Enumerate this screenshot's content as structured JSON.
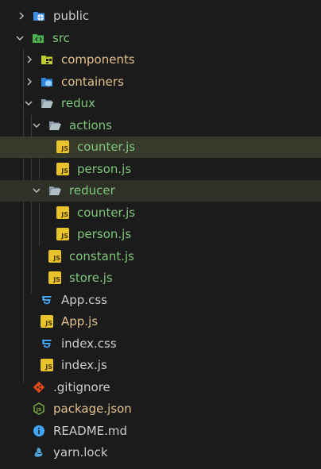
{
  "explorer": {
    "items": [
      {
        "label": "public",
        "kind": "folder",
        "icon": "public-folder-icon",
        "expanded": false
      },
      {
        "label": "src",
        "kind": "folder",
        "icon": "src-folder-icon",
        "expanded": true
      },
      {
        "label": "components",
        "kind": "folder",
        "icon": "components-folder-icon",
        "expanded": false
      },
      {
        "label": "containers",
        "kind": "folder",
        "icon": "containers-folder-icon",
        "expanded": false
      },
      {
        "label": "redux",
        "kind": "folder",
        "icon": "folder-open-icon",
        "expanded": true
      },
      {
        "label": "actions",
        "kind": "folder",
        "icon": "folder-open-icon",
        "expanded": true
      },
      {
        "label": "counter.js",
        "kind": "file",
        "icon": "js-file-icon",
        "selected": true
      },
      {
        "label": "person.js",
        "kind": "file",
        "icon": "js-file-icon"
      },
      {
        "label": "reducer",
        "kind": "folder",
        "icon": "folder-open-icon",
        "expanded": true
      },
      {
        "label": "counter.js",
        "kind": "file",
        "icon": "js-file-icon"
      },
      {
        "label": "person.js",
        "kind": "file",
        "icon": "js-file-icon"
      },
      {
        "label": "constant.js",
        "kind": "file",
        "icon": "js-file-icon"
      },
      {
        "label": "store.js",
        "kind": "file",
        "icon": "js-file-icon"
      },
      {
        "label": "App.css",
        "kind": "file",
        "icon": "css-file-icon"
      },
      {
        "label": "App.js",
        "kind": "file",
        "icon": "js-file-icon"
      },
      {
        "label": "index.css",
        "kind": "file",
        "icon": "css-file-icon"
      },
      {
        "label": "index.js",
        "kind": "file",
        "icon": "js-file-icon"
      },
      {
        "label": ".gitignore",
        "kind": "file",
        "icon": "git-icon"
      },
      {
        "label": "package.json",
        "kind": "file",
        "icon": "node-icon"
      },
      {
        "label": "README.md",
        "kind": "file",
        "icon": "info-icon"
      },
      {
        "label": "yarn.lock",
        "kind": "file",
        "icon": "yarn-icon"
      }
    ],
    "js_badge": "JS",
    "colors": {
      "background": "#1b1b1b",
      "selection": "#37392b",
      "modified_green": "#7ec77a",
      "untracked_yellow": "#e2c08d",
      "js_yellow": "#e8c32b",
      "css_blue": "#42a5f5"
    }
  }
}
